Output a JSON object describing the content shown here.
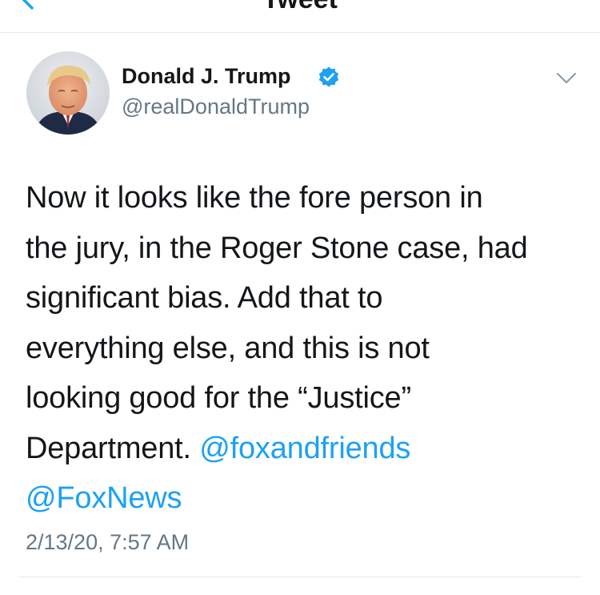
{
  "header": {
    "title": "Tweet",
    "back_icon": "chevron-left-icon",
    "accent": "#1da1f2"
  },
  "tweet": {
    "author": {
      "display_name": "Donald J. Trump",
      "handle": "@realDonaldTrump",
      "verified_icon": "verified-badge-icon",
      "verified_color": "#1da1f2"
    },
    "menu_icon": "chevron-down-icon",
    "lines": [
      "Now it looks like the fore person in",
      "the jury, in the Roger Stone case, had",
      "significant bias. Add that to",
      "everything else, and this is not",
      "looking good for the “Justice”",
      "Department. "
    ],
    "mentions": [
      "@foxandfriends",
      "@FoxNews"
    ],
    "timestamp": "2/13/20, 7:57 AM"
  },
  "colors": {
    "text": "#14171a",
    "secondary": "#657786",
    "link": "#1da1f2",
    "divider": "#e1e8ed"
  }
}
